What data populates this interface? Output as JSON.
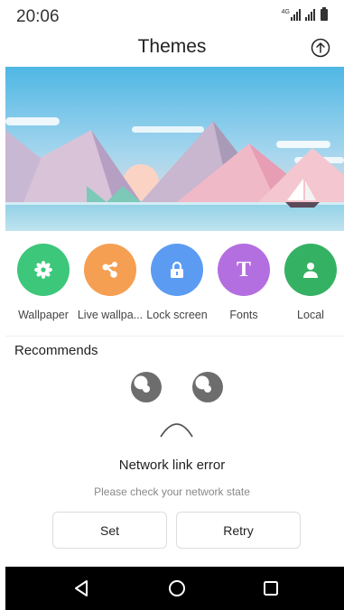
{
  "status": {
    "time": "20:06",
    "network": "4G"
  },
  "header": {
    "title": "Themes"
  },
  "categories": [
    {
      "label": "Wallpaper",
      "color": "#3cc77a",
      "icon": "flower-icon"
    },
    {
      "label": "Live wallpa...",
      "color": "#f59f52",
      "icon": "share-nodes-icon"
    },
    {
      "label": "Lock screen",
      "color": "#5b9cf2",
      "icon": "lock-icon"
    },
    {
      "label": "Fonts",
      "color": "#b36ee0",
      "icon": "font-T-icon"
    },
    {
      "label": "Local",
      "color": "#35b163",
      "icon": "person-icon"
    }
  ],
  "recommends": {
    "heading": "Recommends"
  },
  "error": {
    "title": "Network link error",
    "message": "Please check your network state"
  },
  "buttons": {
    "set": "Set",
    "retry": "Retry"
  }
}
